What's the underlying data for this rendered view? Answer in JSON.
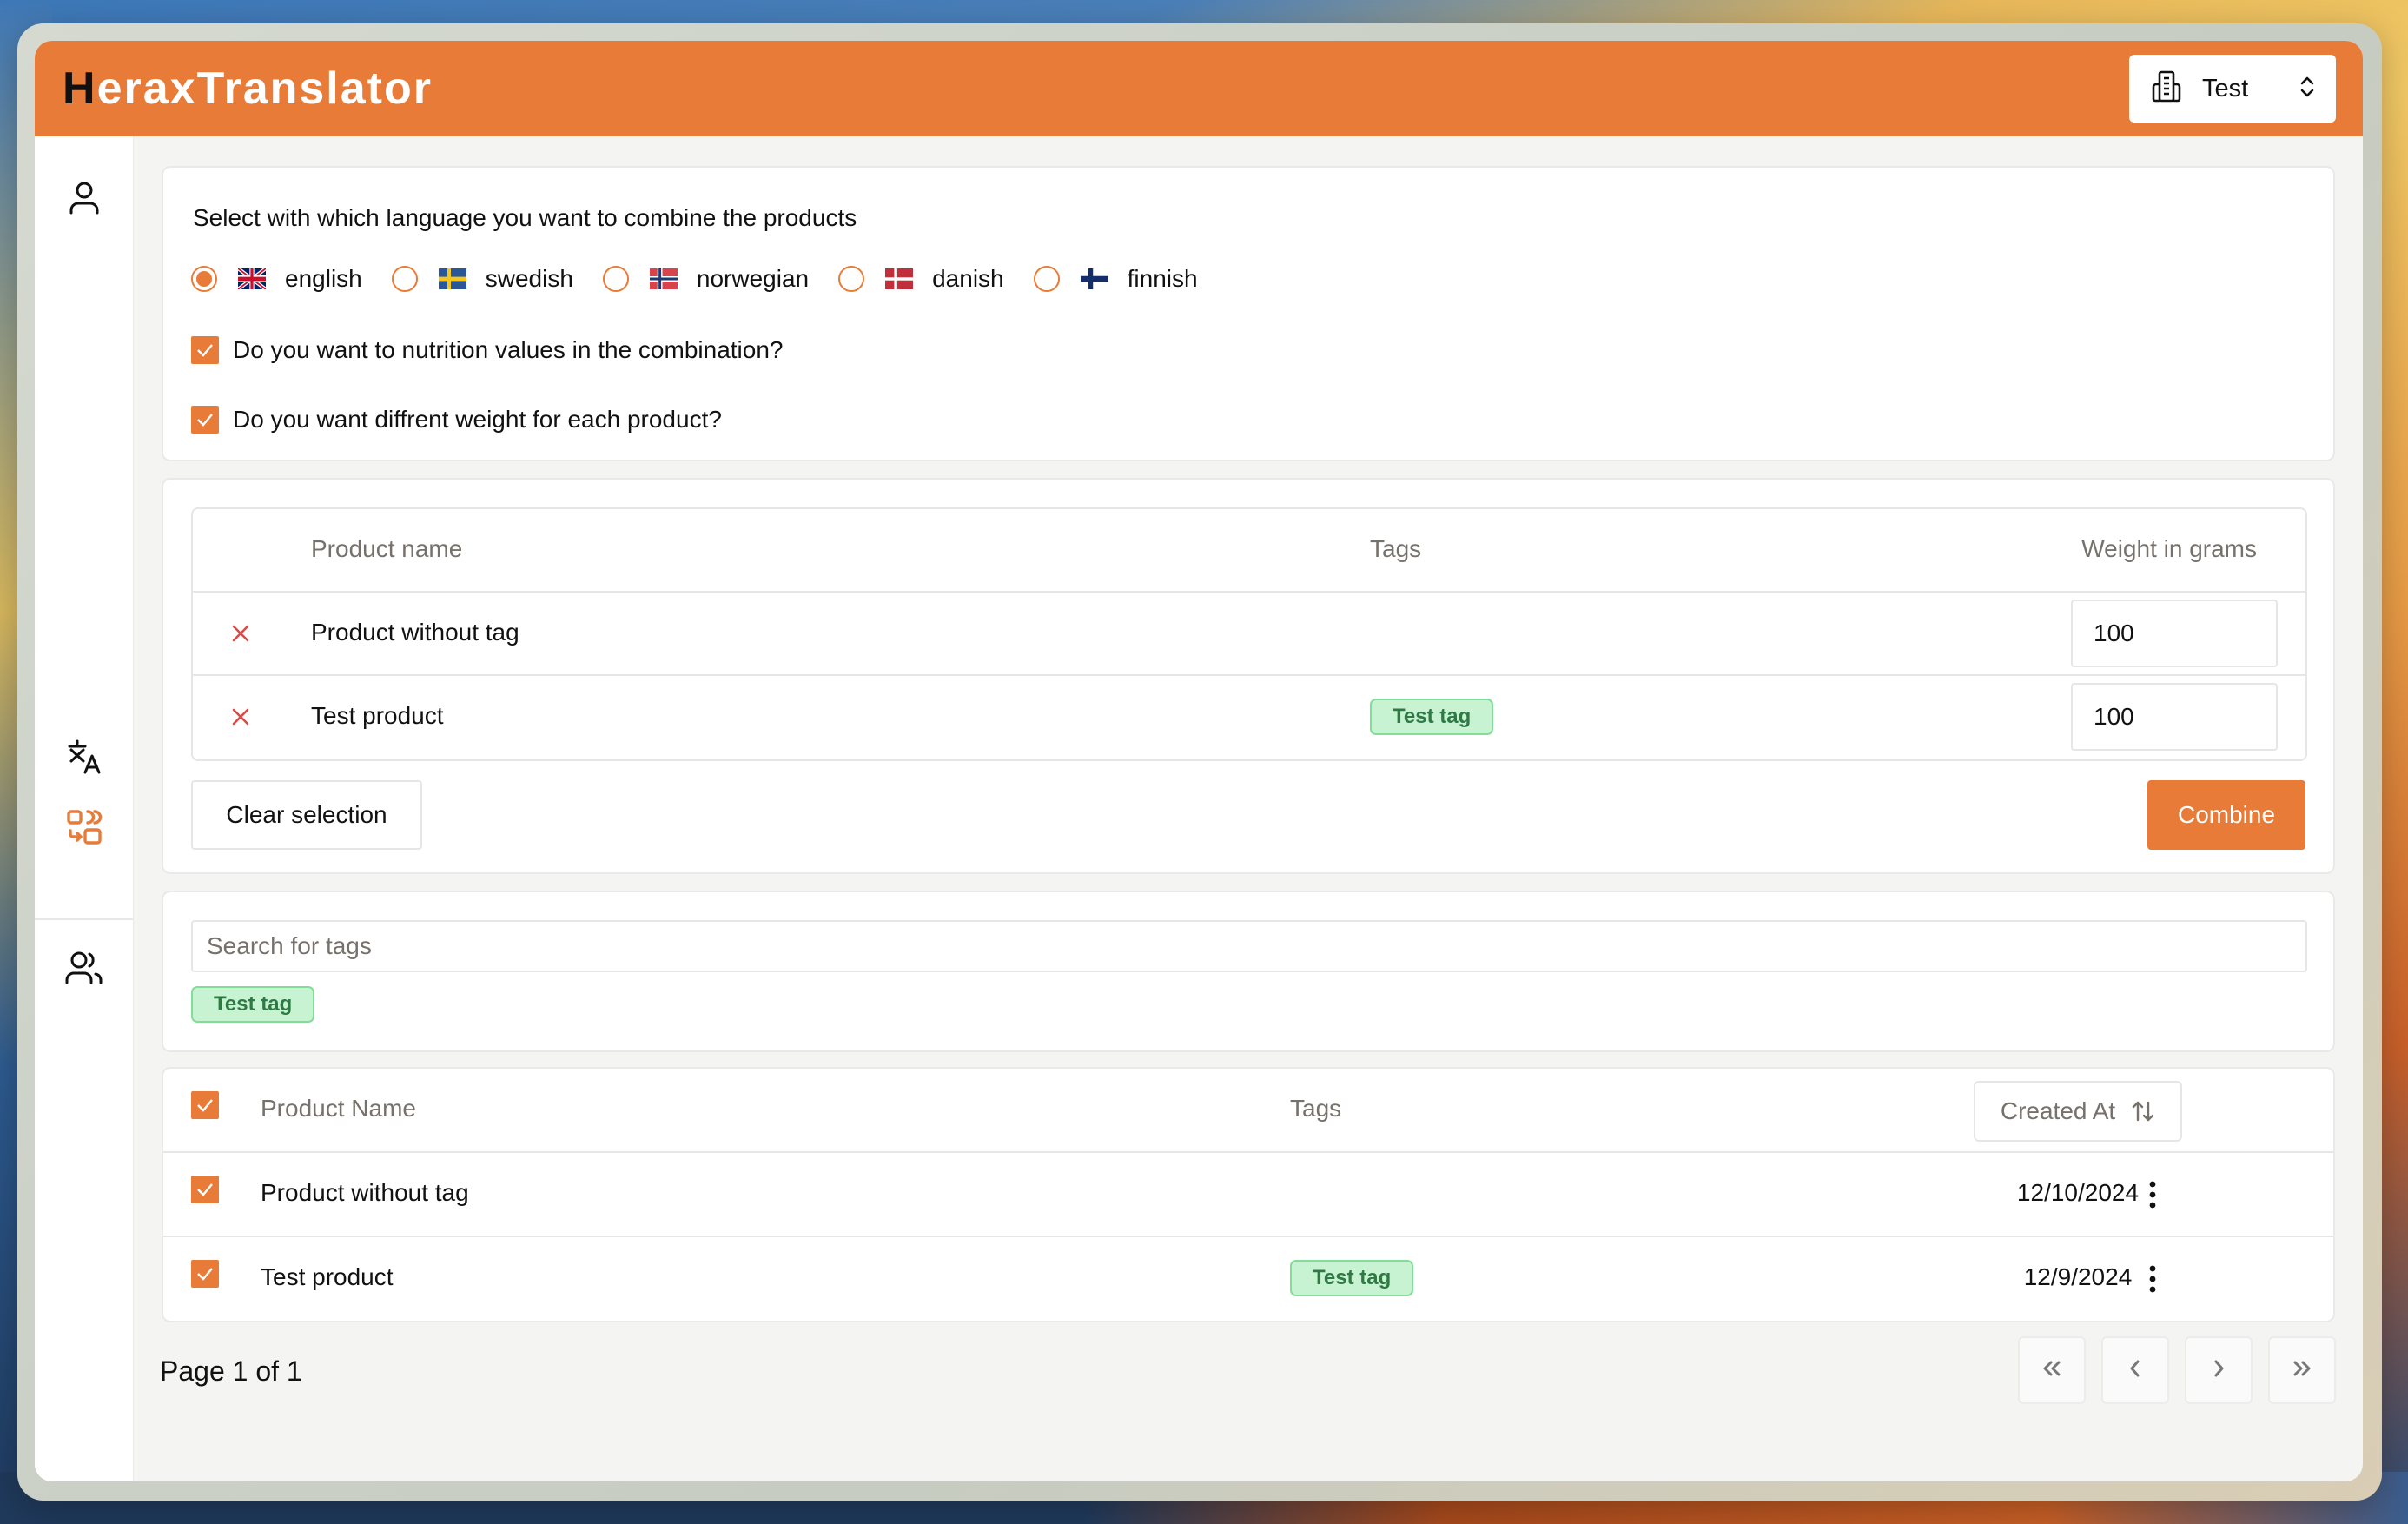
{
  "app": {
    "title_initial": "H",
    "title_rest": "eraxTranslator",
    "brand_color": "#e87b37",
    "org_selector": {
      "label": "Test",
      "icon": "building-icon",
      "chevron": "chevron-up-down-icon"
    }
  },
  "sidebar": {
    "items": [
      {
        "name": "profile",
        "icon": "user-icon",
        "active": false
      },
      {
        "name": "translate",
        "icon": "translate-icon",
        "active": false
      },
      {
        "name": "combine",
        "icon": "combine-icon",
        "active": true
      },
      {
        "name": "users",
        "icon": "users-icon",
        "active": false
      }
    ]
  },
  "language_card": {
    "prompt": "Select with which language you want to combine the products",
    "languages": [
      {
        "label": "english",
        "flag": "uk-flag-icon",
        "selected": true
      },
      {
        "label": "swedish",
        "flag": "sweden-flag-icon",
        "selected": false
      },
      {
        "label": "norwegian",
        "flag": "norway-flag-icon",
        "selected": false
      },
      {
        "label": "danish",
        "flag": "denmark-flag-icon",
        "selected": false
      },
      {
        "label": "finnish",
        "flag": "finland-flag-icon",
        "selected": false
      }
    ],
    "options": [
      {
        "label": "Do you want to nutrition values in the combination?",
        "checked": true
      },
      {
        "label": "Do you want diffrent weight for each product?",
        "checked": true
      }
    ]
  },
  "selection_card": {
    "columns": [
      "Product name",
      "Tags",
      "Weight in grams"
    ],
    "rows": [
      {
        "name": "Product without tag",
        "tags": [],
        "weight": "100"
      },
      {
        "name": "Test product",
        "tags": [
          "Test tag"
        ],
        "weight": "100"
      }
    ],
    "clear_label": "Clear selection",
    "combine_label": "Combine"
  },
  "tag_search": {
    "placeholder": "Search for tags",
    "value": "",
    "tags": [
      "Test tag"
    ]
  },
  "products_table": {
    "columns": {
      "name": "Product Name",
      "tags": "Tags",
      "created": "Created At"
    },
    "header_checked": true,
    "rows": [
      {
        "name": "Product without tag",
        "tags": [],
        "created": "12/10/2024",
        "checked": true
      },
      {
        "name": "Test product",
        "tags": [
          "Test tag"
        ],
        "created": "12/9/2024",
        "checked": true
      }
    ]
  },
  "pagination": {
    "label": "Page 1 of 1",
    "buttons": [
      "first-page",
      "previous-page",
      "next-page",
      "last-page"
    ]
  }
}
